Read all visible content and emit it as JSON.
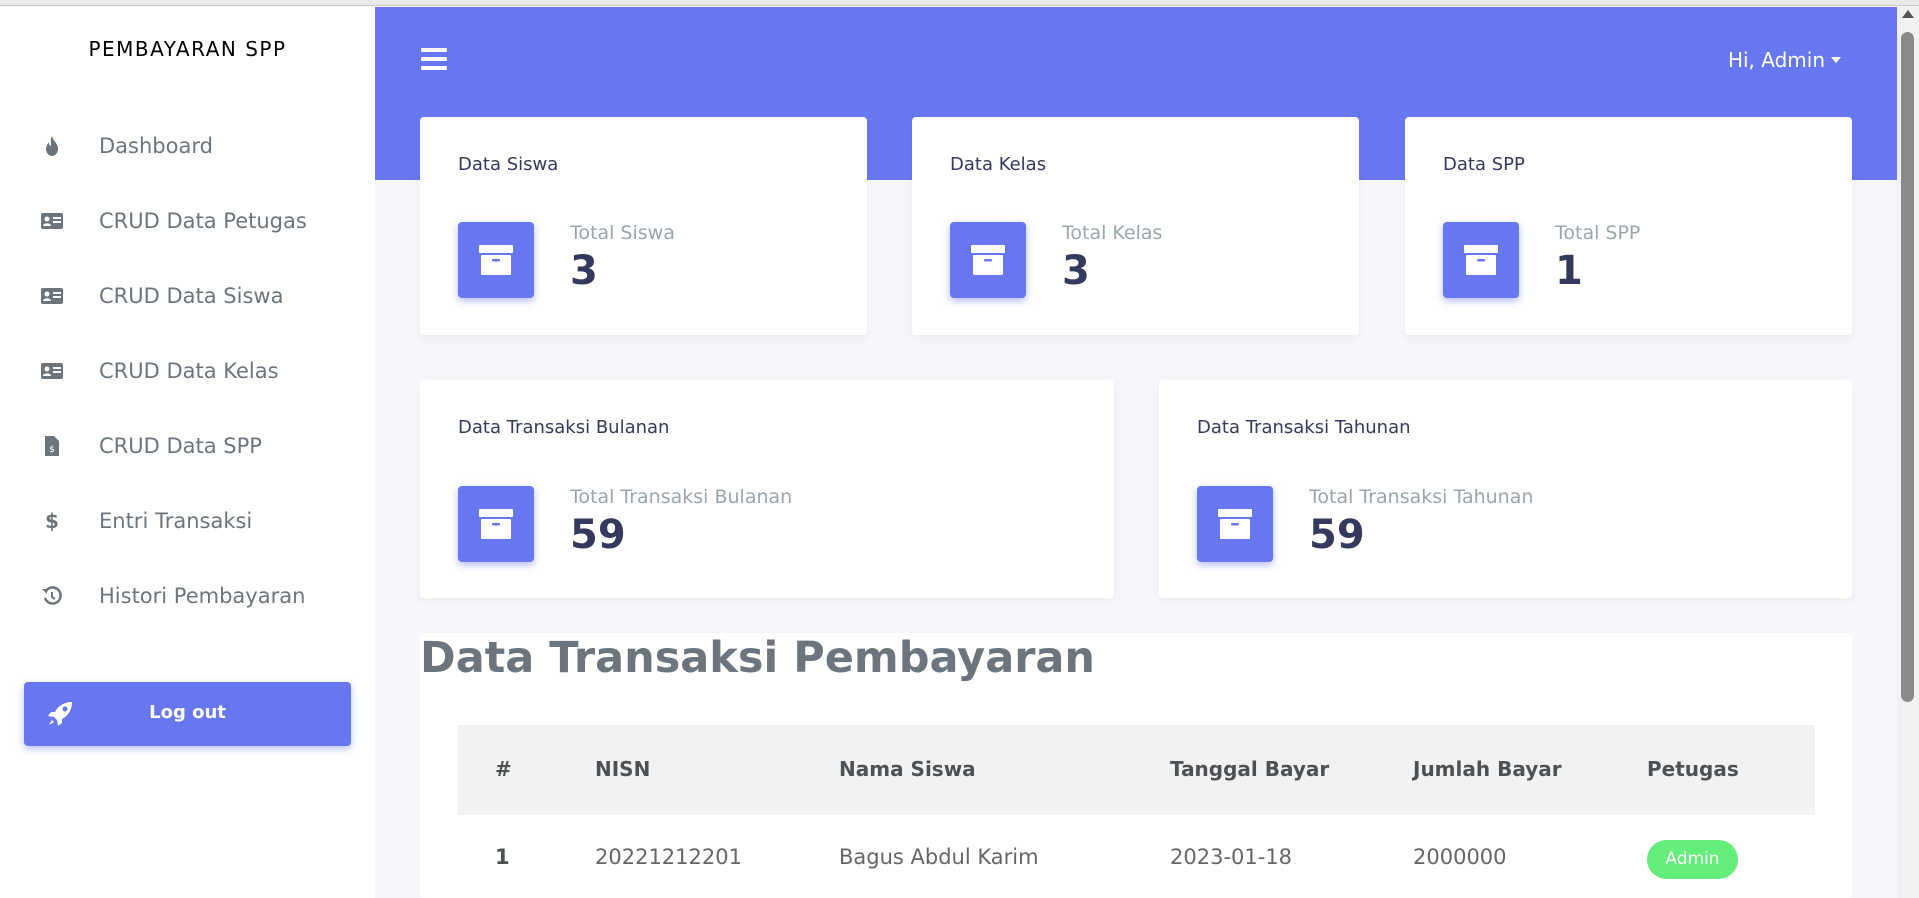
{
  "brand": "PEMBAYARAN SPP",
  "sidebar": {
    "items": [
      {
        "label": "Dashboard",
        "icon": "fire-icon"
      },
      {
        "label": "CRUD Data Petugas",
        "icon": "id-card-icon"
      },
      {
        "label": "CRUD Data Siswa",
        "icon": "id-card-icon"
      },
      {
        "label": "CRUD Data Kelas",
        "icon": "id-card-icon"
      },
      {
        "label": "CRUD Data SPP",
        "icon": "file-invoice-dollar-icon"
      },
      {
        "label": "Entri Transaksi",
        "icon": "dollar-icon"
      },
      {
        "label": "Histori Pembayaran",
        "icon": "history-icon"
      }
    ],
    "logout_label": "Log out"
  },
  "navbar": {
    "user_label": "Hi, Admin"
  },
  "stats": [
    {
      "title": "Data Siswa",
      "sub": "Total Siswa",
      "value": "3"
    },
    {
      "title": "Data Kelas",
      "sub": "Total Kelas",
      "value": "3"
    },
    {
      "title": "Data SPP",
      "sub": "Total SPP",
      "value": "1"
    },
    {
      "title": "Data Transaksi Bulanan",
      "sub": "Total Transaksi Bulanan",
      "value": "59"
    },
    {
      "title": "Data Transaksi Tahunan",
      "sub": "Total Transaksi Tahunan",
      "value": "59"
    }
  ],
  "transactions": {
    "title": "Data Transaksi Pembayaran",
    "columns": [
      "#",
      "NISN",
      "Nama Siswa",
      "Tanggal Bayar",
      "Jumlah Bayar",
      "Petugas"
    ],
    "rows": [
      {
        "no": "1",
        "nisn": "20221212201",
        "nama": "Bagus Abdul Karim",
        "tanggal": "2023-01-18",
        "jumlah": "2000000",
        "petugas": "Admin"
      }
    ]
  },
  "colors": {
    "primary": "#6777ef",
    "success": "#63ed7a",
    "text_muted": "#6c757d"
  }
}
